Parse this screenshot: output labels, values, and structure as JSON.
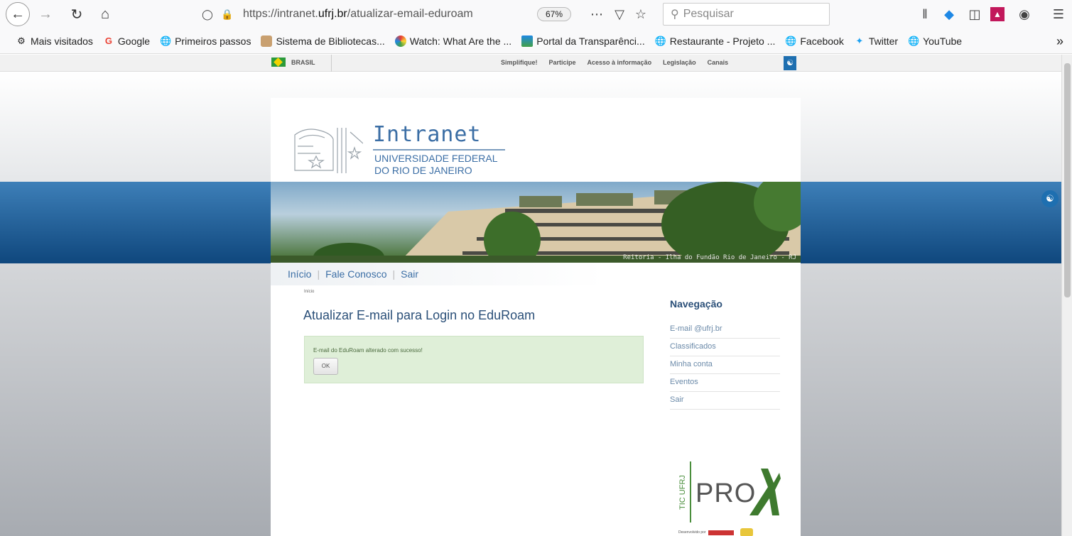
{
  "browser": {
    "url_prefix": "https://intranet.",
    "url_host": "ufrj.br",
    "url_path": "/atualizar-email-eduroam",
    "zoom": "67%",
    "search_placeholder": "Pesquisar"
  },
  "bookmarks": [
    {
      "label": "Mais visitados",
      "icon": "gear-icon"
    },
    {
      "label": "Google",
      "icon": "google-icon"
    },
    {
      "label": "Primeiros passos",
      "icon": "globe-icon"
    },
    {
      "label": "Sistema de Bibliotecas...",
      "icon": "library-icon"
    },
    {
      "label": "Watch: What Are the ...",
      "icon": "video-icon"
    },
    {
      "label": "Portal da Transparênci...",
      "icon": "portal-icon"
    },
    {
      "label": "Restaurante - Projeto ...",
      "icon": "globe-icon"
    },
    {
      "label": "Facebook",
      "icon": "globe-icon"
    },
    {
      "label": "Twitter",
      "icon": "twitter-icon"
    },
    {
      "label": "YouTube",
      "icon": "globe-icon"
    }
  ],
  "govbar": {
    "brasil": "BRASIL",
    "links": [
      "Simplifique!",
      "Participe",
      "Acesso à informação",
      "Legislação",
      "Canais"
    ]
  },
  "site": {
    "logo_title": "Intranet",
    "logo_sub1": "UNIVERSIDADE FEDERAL",
    "logo_sub2": "DO RIO DE JANEIRO",
    "banner_caption": "Reitoria - Ilha do Fundão Rio de Janeiro - RJ",
    "menu": [
      "Início",
      "Fale Conosco",
      "Sair"
    ],
    "breadcrumb": "Início",
    "page_title": "Atualizar E-mail para Login no EduRoam",
    "success_message": "E-mail do EduRoam alterado com sucesso!",
    "ok_label": "OK",
    "nav_title": "Navegação",
    "nav_items": [
      "E-mail @ufrj.br",
      "Classificados",
      "Minha conta",
      "Eventos",
      "Sair"
    ],
    "proxy_tic": "TIC UFRJ",
    "proxy_logo": "PRO",
    "proxy_dev": "Desenvolvido por"
  },
  "colors": {
    "accent": "#3b6ea5",
    "band": "#0f477d",
    "success_bg": "#dfefd8"
  }
}
